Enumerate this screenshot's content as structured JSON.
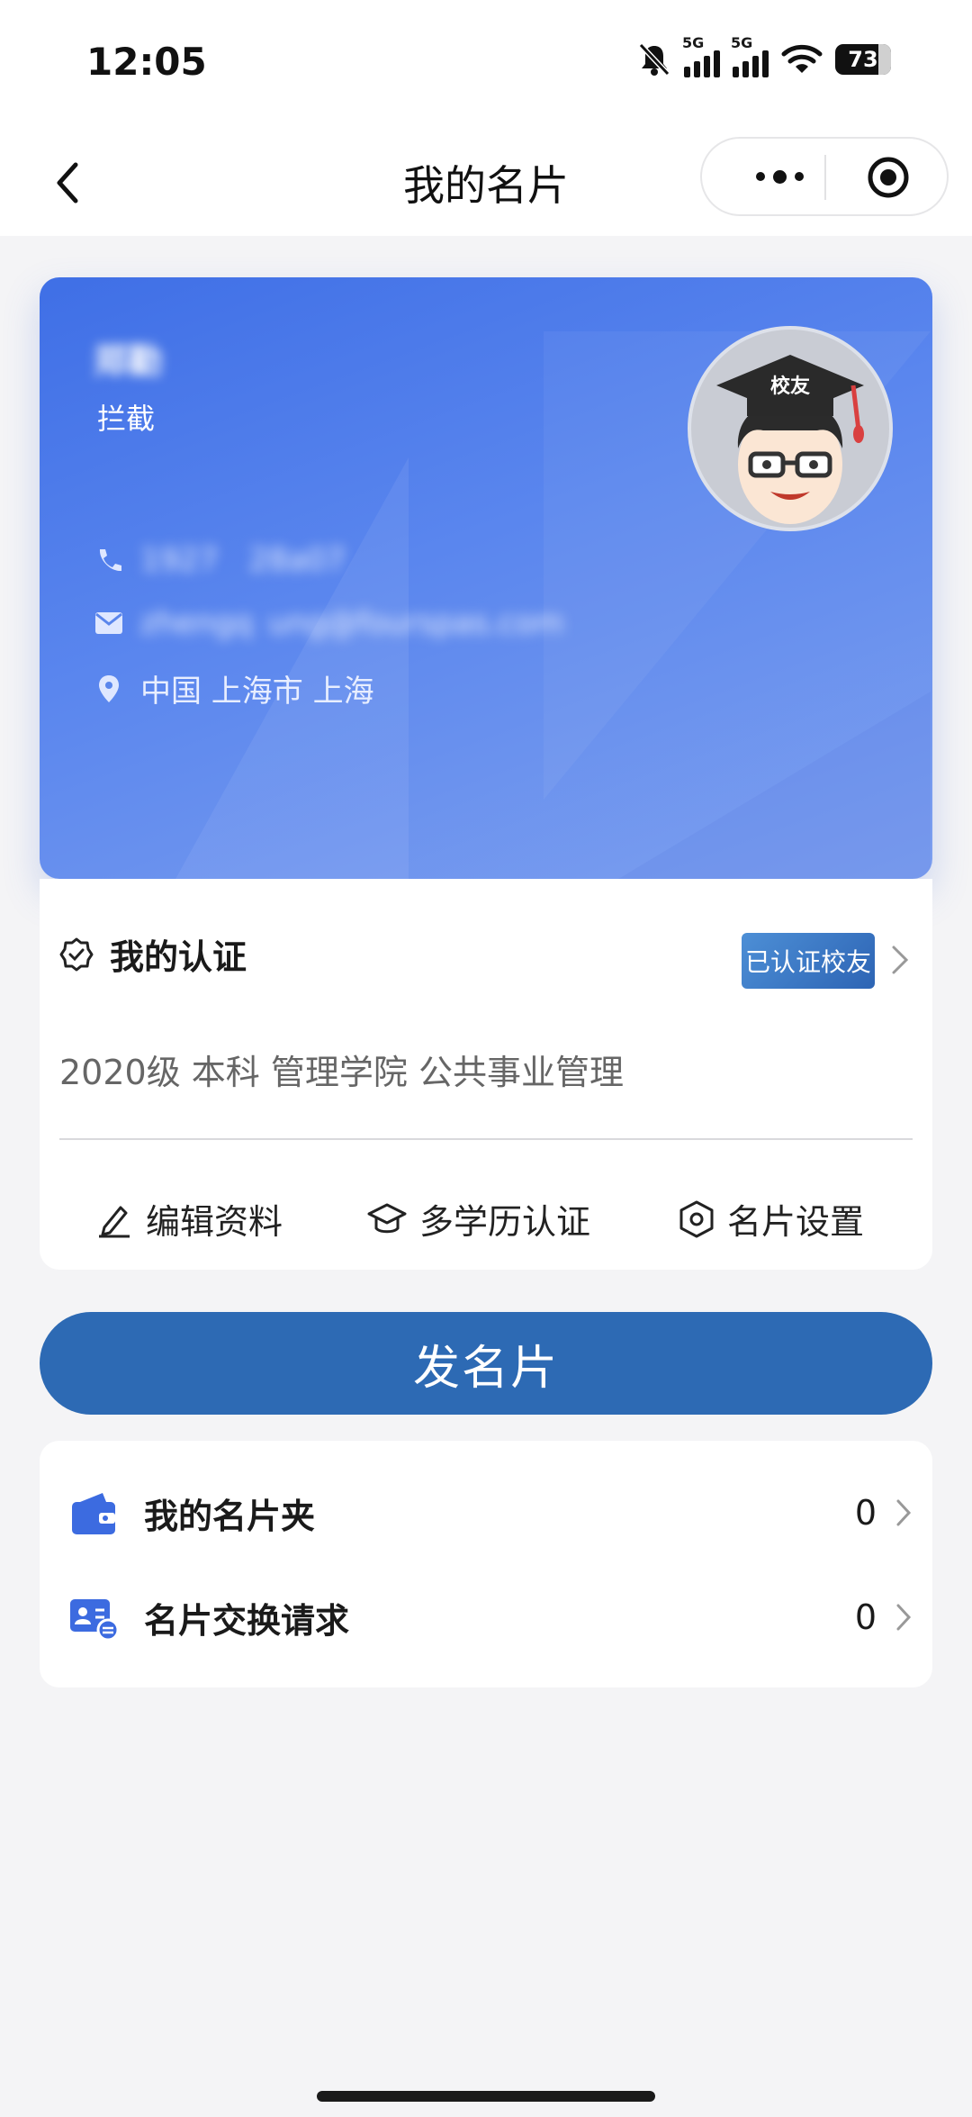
{
  "status_bar": {
    "time": "12:05",
    "battery": "73",
    "network1": "5G",
    "network2": "5G"
  },
  "nav": {
    "title": "我的名片"
  },
  "card": {
    "name": "郑勤",
    "org": "拦截",
    "phone": "1927  28a07",
    "email": "zhengq ung@fourspas.com",
    "location": "中国 上海市 上海",
    "avatar_text": "校友"
  },
  "certification": {
    "title": "我的认证",
    "badge": "已认证校友",
    "education": "2020级 本科 管理学院 公共事业管理"
  },
  "actions": {
    "edit": "编辑资料",
    "multi_degree": "多学历认证",
    "settings": "名片设置"
  },
  "send_button": "发名片",
  "list": [
    {
      "label": "我的名片夹",
      "count": "0"
    },
    {
      "label": "名片交换请求",
      "count": "0"
    }
  ],
  "colors": {
    "primary": "#2d6ab4",
    "card_blue": "#4a78e8",
    "icon_blue": "#3c6be0"
  }
}
